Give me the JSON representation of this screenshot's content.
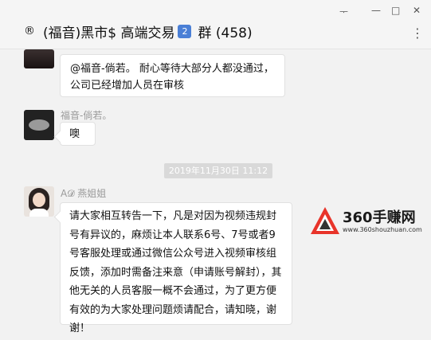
{
  "window": {
    "pin_glyph": "ᅮ",
    "minimize_glyph": "—",
    "maximize_glyph": "□",
    "close_glyph": "✕"
  },
  "header": {
    "reg_symbol": "®",
    "title": "(福音)黑市$ 高端交易",
    "badge": "2",
    "suffix": "群 (458)",
    "more_glyph": "⋮"
  },
  "messages": [
    {
      "sender": "",
      "text": "@福音-倘若。 耐心等待大部分人都没通过，公司已经增加人员在审核"
    },
    {
      "sender": "福音-倘若。",
      "text": "噢"
    },
    {
      "sender": "A𝓓 燕姐姐",
      "text": "请大家相互转告一下，凡是对因为视频违规封号有异议的，麻烦让本人联系6号、7号或者9号客服处理或通过微信公众号进入视频审核组反馈，添加时需备注来意（申请账号解封），其他无关的人员客服一概不会通过，为了更方便有效的为大家处理问题烦请配合，请知晓，谢谢！"
    }
  ],
  "timestamp": "2019年11月30日 11:12",
  "watermark": {
    "brand": "360手赚网",
    "url": "www.360shouzhuan.com"
  },
  "colors": {
    "bubble": "#ffffff",
    "background": "#f2f2f2",
    "badge": "#4a7fd6",
    "watermark_red": "#e8342a"
  }
}
